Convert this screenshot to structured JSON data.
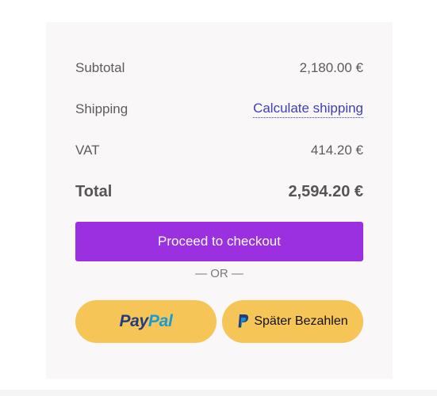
{
  "summary": {
    "subtotal_label": "Subtotal",
    "subtotal_value": "2,180.00 €",
    "shipping_label": "Shipping",
    "shipping_link": "Calculate shipping",
    "vat_label": "VAT",
    "vat_value": "414.20 €",
    "total_label": "Total",
    "total_value": "2,594.20 €"
  },
  "actions": {
    "checkout_label": "Proceed to checkout",
    "separator": "— OR —",
    "paypal_pay": "Pay",
    "paypal_pal": "Pal",
    "pay_later_label": "Später Bezahlen"
  },
  "icons": {
    "paypal_logo": "paypal-logo",
    "paypal_mark": "paypal-p-icon"
  },
  "colors": {
    "checkout_button": "#9b30e0",
    "paypal_button": "#f6c557",
    "link": "#3d3fba",
    "paypal_dark_blue": "#253b80",
    "paypal_light_blue": "#179bd7"
  }
}
